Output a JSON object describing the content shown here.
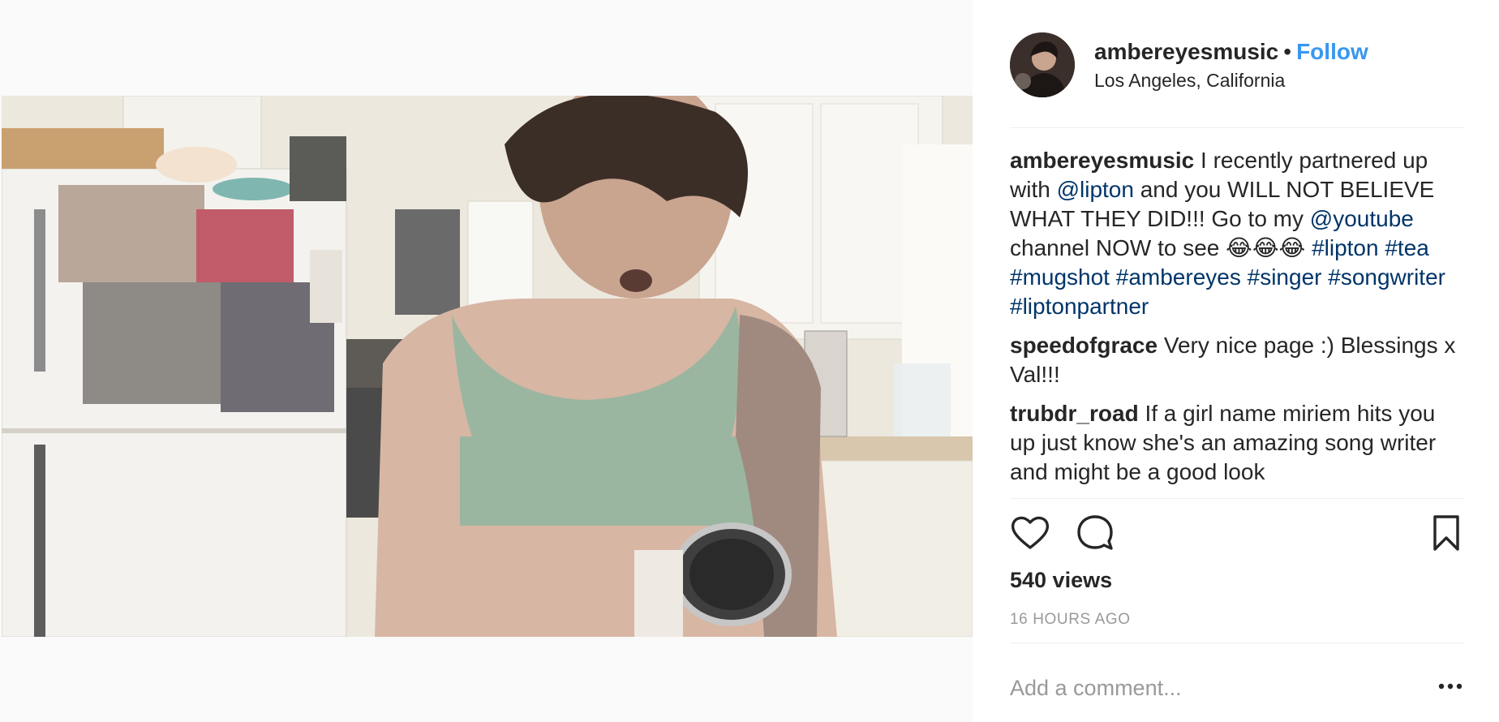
{
  "post": {
    "username": "ambereyesmusic",
    "separator": "•",
    "follow_label": "Follow",
    "location": "Los Angeles, California"
  },
  "comments": [
    {
      "user": "ambereyesmusic",
      "parts": [
        {
          "t": " I recently partnered up with "
        },
        {
          "t": "@lipton",
          "link": true
        },
        {
          "t": " and you WILL NOT BELIEVE WHAT THEY DID!!! Go to my "
        },
        {
          "t": "@youtube",
          "link": true
        },
        {
          "t": " channel NOW to see 😂😂😂 "
        },
        {
          "t": "#lipton",
          "link": true
        },
        {
          "t": " "
        },
        {
          "t": "#tea",
          "link": true
        },
        {
          "t": " "
        },
        {
          "t": "#mugshot",
          "link": true
        },
        {
          "t": " "
        },
        {
          "t": "#ambereyes",
          "link": true
        },
        {
          "t": " "
        },
        {
          "t": "#singer",
          "link": true
        },
        {
          "t": " "
        },
        {
          "t": "#songwriter",
          "link": true
        },
        {
          "t": " "
        },
        {
          "t": "#liptonpartner",
          "link": true
        }
      ]
    },
    {
      "user": "speedofgrace",
      "parts": [
        {
          "t": " Very nice page :) Blessings x Val!!!"
        }
      ]
    },
    {
      "user": "trubdr_road",
      "parts": [
        {
          "t": " If a girl name miriem hits you up just know she's an amazing song writer and might be a good look"
        }
      ]
    }
  ],
  "stats": {
    "views": "540 views",
    "time": "16 HOURS AGO"
  },
  "comment_box": {
    "placeholder": "Add a comment..."
  },
  "icons": {
    "like": "heart-icon",
    "comment": "comment-bubble-icon",
    "save": "bookmark-icon",
    "more": "more-options-icon"
  },
  "colors": {
    "link": "#003569",
    "follow": "#3897f0",
    "muted": "#999999",
    "text": "#262626"
  }
}
